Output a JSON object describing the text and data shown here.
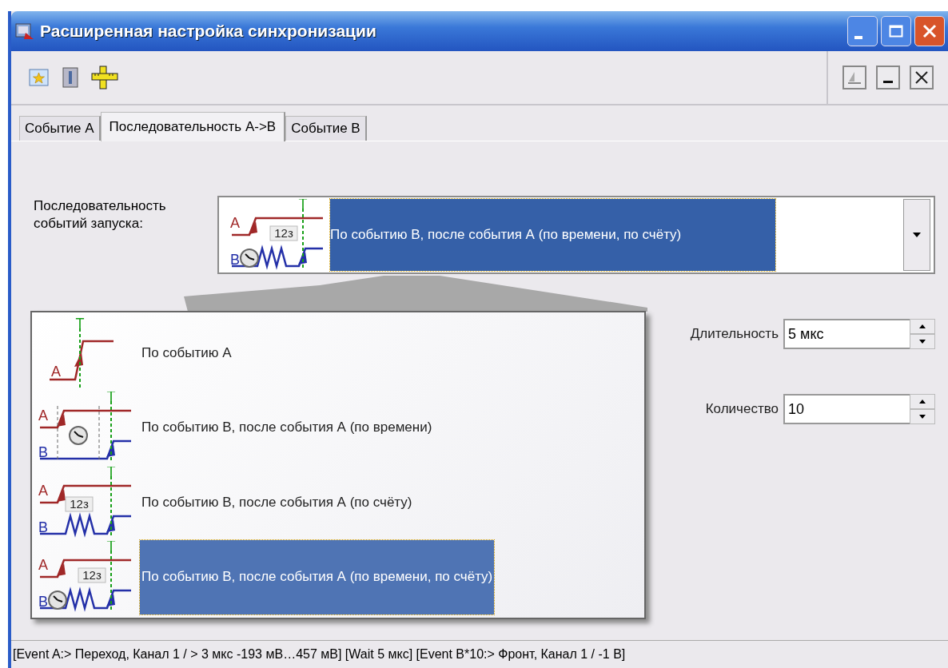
{
  "window": {
    "title": "Расширенная настройка синхронизации"
  },
  "tabs": [
    {
      "label": "Событие А",
      "selected": false
    },
    {
      "label": "Последовательность А->В",
      "selected": true
    },
    {
      "label": "Событие В",
      "selected": false
    }
  ],
  "combo": {
    "label": "Последовательность событий запуска:",
    "value": "По событию В, после события А (по времени, по счёту)",
    "icon": {
      "kind": "time_count",
      "a": "A",
      "b": "B",
      "t": "T",
      "counter": "12з"
    }
  },
  "options": [
    {
      "label": "По событию А",
      "selected": false,
      "icon": {
        "kind": "a",
        "a": "A",
        "t": "T"
      }
    },
    {
      "label": "По событию В, после события А (по времени)",
      "selected": false,
      "icon": {
        "kind": "time",
        "a": "A",
        "b": "B",
        "t": "T"
      }
    },
    {
      "label": "По событию В, после события А (по счёту)",
      "selected": false,
      "icon": {
        "kind": "count",
        "a": "A",
        "b": "B",
        "t": "T",
        "counter": "12з"
      }
    },
    {
      "label": "По событию В, после события А (по времени, по счёту)",
      "selected": true,
      "icon": {
        "kind": "time_count",
        "a": "A",
        "b": "B",
        "t": "T",
        "counter": "12з"
      }
    }
  ],
  "fields": [
    {
      "label": "Длительность",
      "value": "5 мкс"
    },
    {
      "label": "Количество",
      "value": "10"
    }
  ],
  "status_bar": "[Event A:> Переход, Канал 1 / > 3 мкс -193 мВ…457 мВ] [Wait 5 мкс] [Event B*10:> Фронт, Канал 1 / -1 В]"
}
